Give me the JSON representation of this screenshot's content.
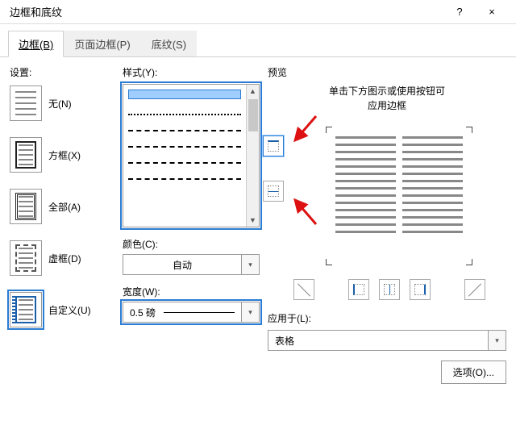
{
  "window": {
    "title": "边框和底纹",
    "help": "?",
    "close": "×"
  },
  "tabs": [
    {
      "label": "边框(B)"
    },
    {
      "label": "页面边框(P)"
    },
    {
      "label": "底纹(S)"
    }
  ],
  "settings": {
    "label": "设置:",
    "items": [
      {
        "label": "无(N)"
      },
      {
        "label": "方框(X)"
      },
      {
        "label": "全部(A)"
      },
      {
        "label": "虚框(D)"
      },
      {
        "label": "自定义(U)"
      }
    ]
  },
  "style": {
    "label": "样式(Y):",
    "color_label": "颜色(C):",
    "color_value": "自动",
    "width_label": "宽度(W):",
    "width_value": "0.5 磅"
  },
  "preview": {
    "label": "预览",
    "hint_line1": "单击下方图示或使用按钮可",
    "hint_line2": "应用边框",
    "apply_label": "应用于(L):",
    "apply_value": "表格",
    "options_label": "选项(O)..."
  }
}
